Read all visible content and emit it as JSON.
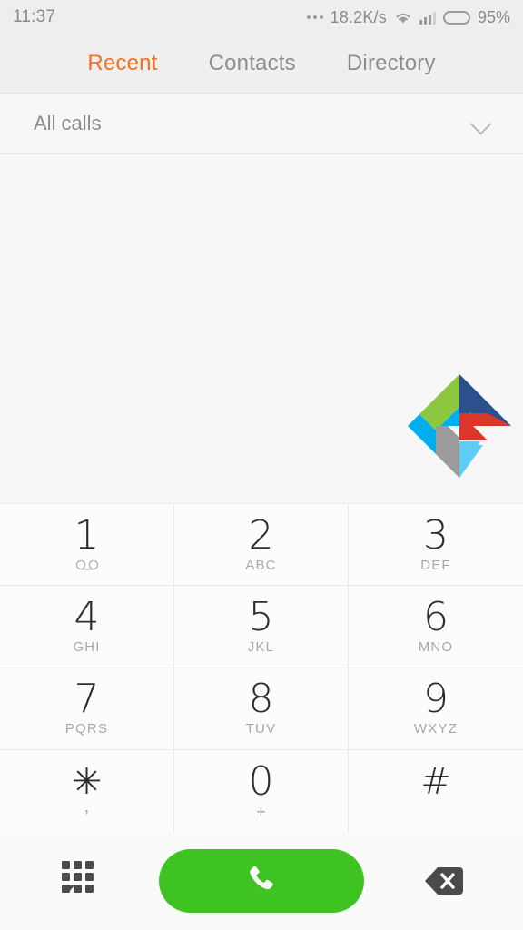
{
  "status_bar": {
    "time": "11:37",
    "network_speed": "18.2K/s",
    "battery_percent": "95%",
    "icons": [
      "more-dots-icon",
      "wifi-icon",
      "signal-icon",
      "battery-icon"
    ]
  },
  "tabs": [
    {
      "label": "Recent",
      "active": true
    },
    {
      "label": "Contacts",
      "active": false
    },
    {
      "label": "Directory",
      "active": false
    }
  ],
  "filter": {
    "label": "All calls",
    "chevron": "chevron-down-icon"
  },
  "logo": {
    "name": "app-logo-watermark",
    "colors": [
      "#8dc63f",
      "#2e4f8f",
      "#00aeef",
      "#d9372a",
      "#9b9b9b",
      "#5ecdf5"
    ]
  },
  "dialpad": {
    "keys": [
      {
        "digit": "1",
        "sub": "",
        "sub_icon": "voicemail-icon",
        "name": "dialpad-key-1"
      },
      {
        "digit": "2",
        "sub": "ABC",
        "sub_icon": "",
        "name": "dialpad-key-2"
      },
      {
        "digit": "3",
        "sub": "DEF",
        "sub_icon": "",
        "name": "dialpad-key-3"
      },
      {
        "digit": "4",
        "sub": "GHI",
        "sub_icon": "",
        "name": "dialpad-key-4"
      },
      {
        "digit": "5",
        "sub": "JKL",
        "sub_icon": "",
        "name": "dialpad-key-5"
      },
      {
        "digit": "6",
        "sub": "MNO",
        "sub_icon": "",
        "name": "dialpad-key-6"
      },
      {
        "digit": "7",
        "sub": "PQRS",
        "sub_icon": "",
        "name": "dialpad-key-7"
      },
      {
        "digit": "8",
        "sub": "TUV",
        "sub_icon": "",
        "name": "dialpad-key-8"
      },
      {
        "digit": "9",
        "sub": "WXYZ",
        "sub_icon": "",
        "name": "dialpad-key-9"
      },
      {
        "digit": "✳",
        "sub": ",",
        "sub_icon": "",
        "name": "dialpad-key-star"
      },
      {
        "digit": "0",
        "sub": "+",
        "sub_icon": "",
        "name": "dialpad-key-0"
      },
      {
        "digit": "#",
        "sub": "",
        "sub_icon": "",
        "name": "dialpad-key-hash"
      }
    ]
  },
  "action_bar": {
    "hide_keypad": "keypad-icon",
    "call": "call-icon",
    "call_color": "#3fc322",
    "backspace": "backspace-icon"
  },
  "colors": {
    "accent": "#f37021",
    "background": "#f7f7f7",
    "dialpad_background": "#fcfcfc",
    "call_green": "#3fc322"
  }
}
